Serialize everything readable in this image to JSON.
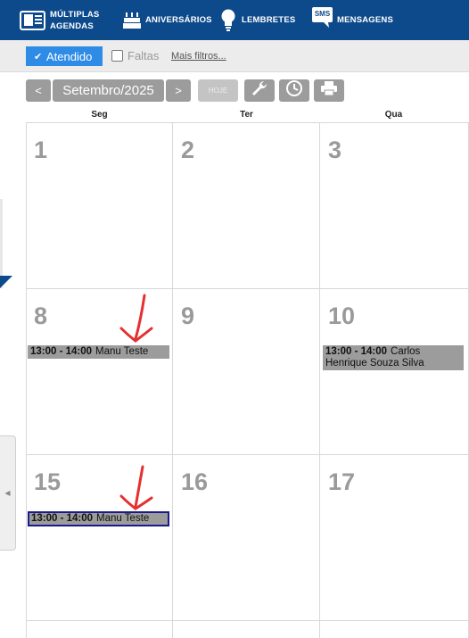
{
  "nav": {
    "multiplas_line1": "MÚLTIPLAS",
    "multiplas_line2": "AGENDAS",
    "aniversarios": "ANIVERSÁRIOS",
    "lembretes": "LEMBRETES",
    "sms_icon_text": "SMS",
    "mensagens": "MENSAGENS"
  },
  "filters": {
    "atendido_label": "Atendido",
    "atendido_checked": true,
    "faltas_label": "Faltas",
    "faltas_checked": false,
    "more_filters": "Mais filtros..."
  },
  "calendar": {
    "prev_label": "<",
    "month_label": "Setembro/2025",
    "next_label": ">",
    "today_label": "HOJE",
    "weekdays": [
      "Seg",
      "Ter",
      "Qua"
    ],
    "days": [
      "1",
      "2",
      "3",
      "8",
      "9",
      "10",
      "15",
      "16",
      "17"
    ],
    "events": [
      {
        "time": "13:00 - 14:00",
        "name": "Manu Teste"
      },
      {
        "time": "13:00 - 14:00",
        "name": "Carlos Henrique Souza Silva"
      },
      {
        "time": "13:00 - 14:00",
        "name": "Manu Teste"
      }
    ]
  },
  "colors": {
    "nav_bg": "#0d4a8c",
    "accent": "#2e8be6",
    "button_gray": "#9c9c9c",
    "annotation_red": "#e53030"
  },
  "icons": [
    "agendas-icon",
    "cake-icon",
    "lightbulb-icon",
    "sms-icon",
    "wrench-icon",
    "clock-icon",
    "print-icon",
    "check-icon",
    "collapse-arrow-icon"
  ]
}
